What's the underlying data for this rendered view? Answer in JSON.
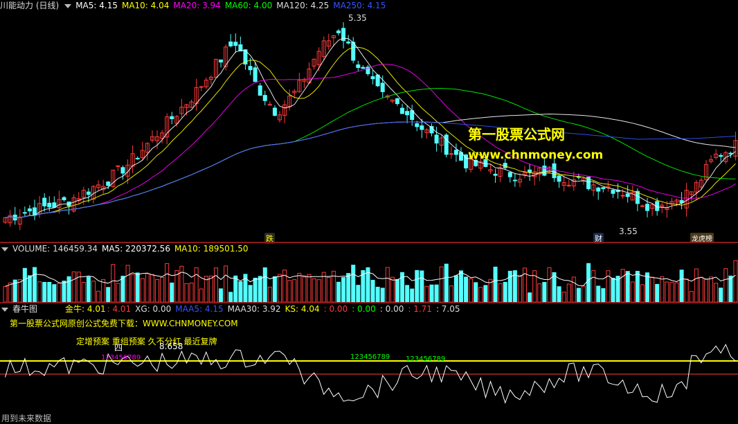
{
  "header": {
    "title": "川能动力 (日线)",
    "ma5": "MA5: 4.15",
    "ma10": "MA10: 4.04",
    "ma20": "MA20: 3.94",
    "ma60": "MA60: 4.00",
    "ma120": "MA120: 4.25",
    "ma250": "MA250: 4.15"
  },
  "price_panel": {
    "high_label": "5.35",
    "low_label": "3.55",
    "markers": [
      "跌",
      "财",
      "龙虎榜"
    ],
    "watermark_title": "第一股票公式网",
    "watermark_url": "www.chnmoney.com"
  },
  "volume_header": {
    "title": "VOLUME: 146459.34",
    "ma5": "MA5: 220372.56",
    "ma10": "MA10: 189501.50"
  },
  "indicator_header": {
    "title": "春牛图",
    "jinniu": "金牛: 4.01",
    "jinniu2": ": 4.01",
    "xg": "XG: 0.00",
    "maa5": "MAA5: 4.15",
    "maa30": "MAA30: 3.92",
    "ks": "KS: 4.04",
    "v1": ": 0.00",
    "v2": ": 0.00",
    "v3": ": 0.00",
    "v4": ": 1.71",
    "v5": ": 7.05"
  },
  "indicator_panel": {
    "promo": "第一股票公式网原创公式免费下载：WWW.CHNMONEY.COM",
    "notes": "定增预案 重组预案 久不分红 最近复牌",
    "label_si": "四",
    "label_value": "8.658",
    "seq1": "123456789",
    "seq2": "123456789",
    "seq3": "123456789"
  },
  "footer": {
    "status": "用到未来数据"
  },
  "colors": {
    "up": "#ff3b3b",
    "down": "#54ffff",
    "ma5": "#ffffff",
    "ma10": "#ffff00",
    "ma20": "#ff00ff",
    "ma60": "#00ff00",
    "ma120": "#ffffff",
    "ma250": "#3355ff",
    "separator": "#8b1a1a"
  },
  "chart_data": {
    "type": "candlestick",
    "title": "川能动力 (日线)",
    "price_range": [
      3.45,
      5.45
    ],
    "high": 5.35,
    "low": 3.55,
    "close_sample": [
      3.6,
      3.65,
      3.7,
      3.75,
      3.85,
      3.95,
      4.1,
      4.3,
      4.5,
      4.7,
      4.95,
      5.2,
      4.8,
      4.55,
      4.75,
      5.1,
      5.3,
      4.95,
      4.7,
      4.6,
      4.4,
      4.25,
      4.1,
      4.05,
      4.0,
      3.98,
      4.02,
      3.95,
      3.9,
      3.88,
      3.8,
      3.7,
      3.75,
      3.85,
      4.15,
      4.25
    ],
    "moving_averages": {
      "MA5": 4.15,
      "MA10": 4.04,
      "MA20": 3.94,
      "MA60": 4.0,
      "MA120": 4.25,
      "MA250": 4.15
    },
    "volume": {
      "last": 146459.34,
      "MA5": 220372.56,
      "MA10": 189501.5
    }
  }
}
